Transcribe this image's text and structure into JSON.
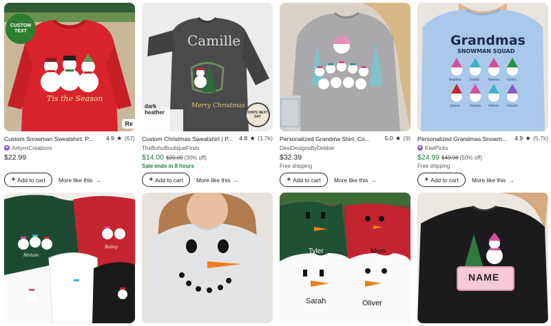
{
  "products": [
    {
      "title": "Custom Snowman Sweatshirt, P...",
      "rating": "4.9",
      "reviews": "(67)",
      "shop": "AnlynnCreations",
      "star_seller": true,
      "price": "$22.99",
      "price_color": "#222222",
      "original_price": "",
      "discount": "",
      "note": "",
      "badge": "CUSTOM TEXT",
      "print_text": "Tis the Season",
      "corner_tag": "Re",
      "cart_label": "Add to cart",
      "more_label": "More like this"
    },
    {
      "title": "Custom Christmas Sweatshirt | P...",
      "rating": "4.8",
      "reviews": "(1.7k)",
      "shop": "TheBohoBoutiqueFinds",
      "star_seller": false,
      "price": "$14.00",
      "price_color": "#1d7a3c",
      "original_price": "$20.00",
      "discount": "(30% off)",
      "note": "Sale ends in 8 hours",
      "print_name": "Camille",
      "print_text": "Merry Christmas",
      "color_label_1": "dark",
      "color_label_2": "heather",
      "badge": "SHIPS NEXT DAY",
      "cart_label": "Add to cart",
      "more_label": "More like this"
    },
    {
      "title": "Personalized Grandma Shirt, Co...",
      "rating": "5.0",
      "reviews": "(9)",
      "shop": "DesiDesignsByDebbie",
      "star_seller": false,
      "price": "$32.39",
      "price_color": "#222222",
      "original_price": "",
      "discount": "",
      "note": "Free shipping",
      "cart_label": "Add to cart",
      "more_label": "More like this"
    },
    {
      "title": "Personalized Grandmas Snowm...",
      "rating": "4.9",
      "reviews": "(5.7k)",
      "shop": "KiwiPicks",
      "star_seller": true,
      "price": "$24.99",
      "price_color": "#1d7a3c",
      "original_price": "$49.98",
      "discount": "(50% off)",
      "note": "Free shipping",
      "print_title": "Grandmas",
      "print_subtitle": "SNOWMAN SQUAD",
      "print_names_row1": [
        "Sophia",
        "Emily",
        "Amelia",
        "Grett"
      ],
      "print_names_row2": [
        "Jason",
        "Emma",
        "Oliver",
        "Claire"
      ],
      "cart_label": "Add to cart",
      "more_label": "More like this"
    }
  ],
  "bottom_images": [
    {
      "names": [
        "Miriam",
        "Bailey"
      ]
    },
    {
      "names": []
    },
    {
      "names": [
        "Tyler",
        "Mom",
        "Sarah",
        "Oliver"
      ]
    },
    {
      "names": [
        "NAME"
      ]
    }
  ],
  "colors": {
    "sale_green": "#1d7a3c",
    "star_seller_purple": "#7f54cc",
    "text": "#222222",
    "muted": "#595959"
  }
}
